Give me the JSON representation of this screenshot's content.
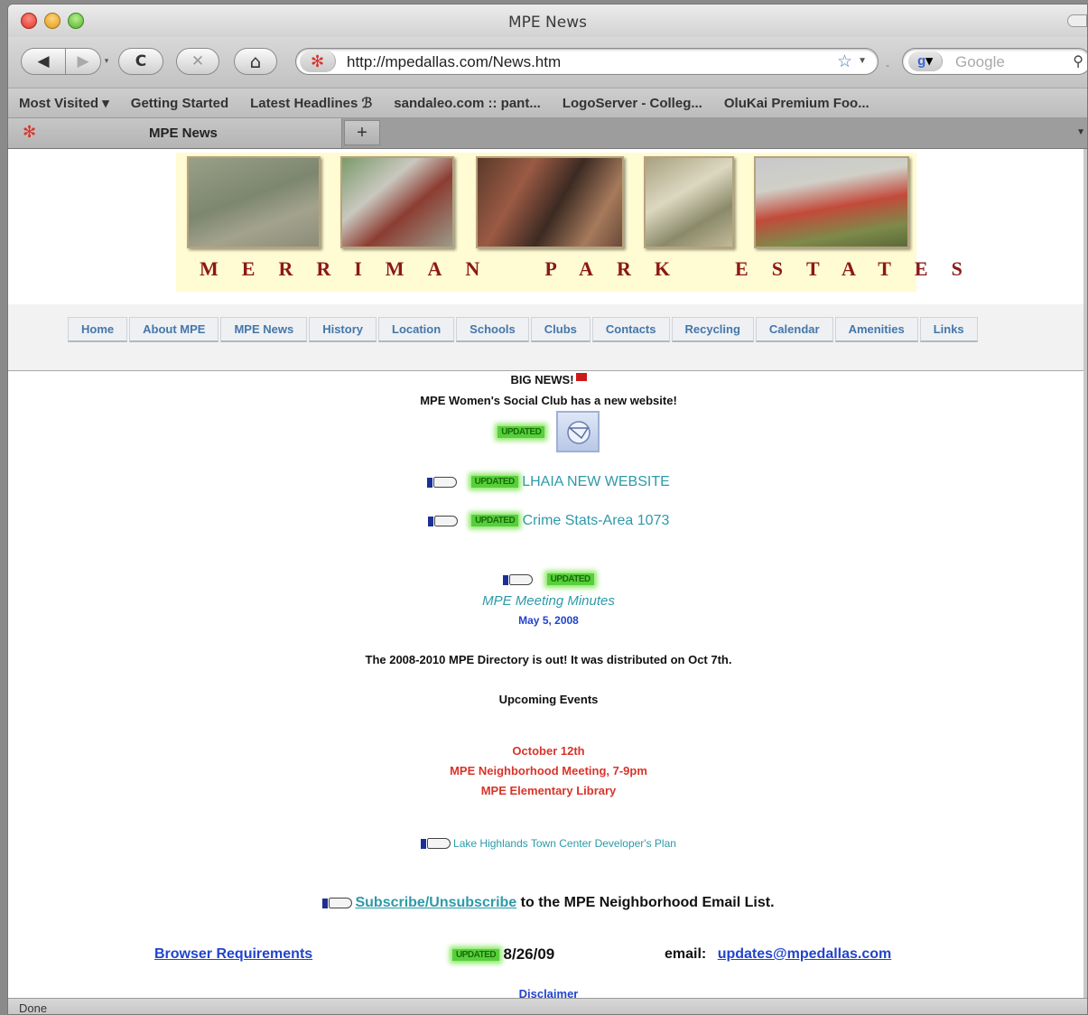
{
  "window": {
    "title": "MPE News"
  },
  "toolbar": {
    "back_glyph": "◀",
    "forward_glyph": "▶",
    "reload_glyph": "C",
    "stop_glyph": "✕",
    "home_glyph": "⌂",
    "url": "http://mpedallas.com/News.htm",
    "search_placeholder": "Google"
  },
  "bookmarks": [
    "Most Visited ▾",
    "Getting Started",
    "Latest Headlines ℬ",
    "sandaleo.com :: pant...",
    "LogoServer - Colleg...",
    "OluKai Premium Foo..."
  ],
  "tab": {
    "title": "MPE News",
    "new_tab": "+"
  },
  "banner": {
    "name": [
      "MERRIMAN",
      "PARK",
      "ESTATES"
    ]
  },
  "nav": {
    "items": [
      "Home",
      "About MPE",
      "MPE News",
      "History",
      "Location",
      "Schools",
      "Clubs",
      "Contacts",
      "Recycling",
      "Calendar",
      "Amenities",
      "Links"
    ]
  },
  "news": {
    "big_news": "BIG NEWS!",
    "womens_club": "MPE Women's Social Club has a new website!",
    "updated_badge": "UPDATED",
    "lhaia_link": "LHAIA NEW WEBSITE",
    "crime_link": "Crime Stats-Area 1073",
    "minutes_link": "MPE Meeting Minutes",
    "minutes_date": "May 5, 2008",
    "directory": "The 2008-2010 MPE Directory is out! It was distributed on Oct 7th.",
    "upcoming": "Upcoming Events",
    "event_date": "October 12th",
    "event_name": "MPE Neighborhood Meeting, 7-9pm",
    "event_place": "MPE Elementary Library",
    "developer_link": "Lake Highlands Town Center Developer's Plan",
    "subscribe_link": "Subscribe/Unsubscribe",
    "subscribe_rest": "to the MPE Neighborhood Email List.",
    "browser_req": "Browser Requirements",
    "update_date": "8/26/09",
    "email_label": "email:",
    "email": "updates@mpedallas.com",
    "disclaimer": "Disclaimer"
  },
  "status": {
    "text": "Done"
  },
  "colors": {
    "accent_red": "#d8342a",
    "link_teal": "#2d9aa8",
    "link_blue": "#2244cc",
    "updated_green": "#56d03a"
  }
}
